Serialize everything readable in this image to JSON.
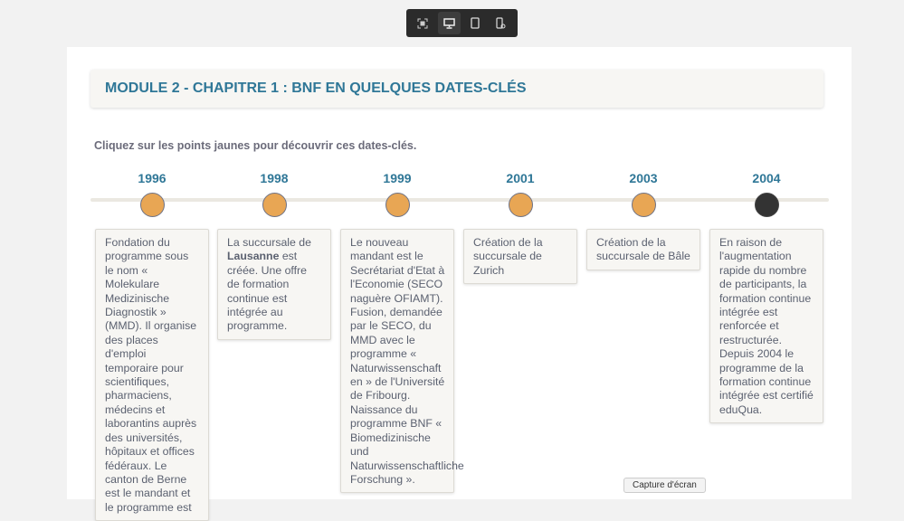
{
  "toolbar": {
    "icons": [
      "fullscreen-icon",
      "desktop-icon",
      "tablet-icon",
      "mobile-rotate-icon"
    ],
    "active": "desktop"
  },
  "header": {
    "title": "MODULE 2 - CHAPITRE 1 : BNF EN QUELQUES DATES-CLÉS"
  },
  "instruction": "Cliquez sur les points jaunes pour découvrir ces dates-clés.",
  "colors": {
    "accent": "#2f7797",
    "dot": "#e8a654",
    "dot_active": "#333333"
  },
  "timeline": [
    {
      "year": "1996",
      "text": "Fondation du programme sous le nom « Molekulare Medizinische Diagnostik » (MMD). Il organise des places d'emploi temporaire pour scientifiques, pharmaciens, médecins et laborantins auprès des universités, hôpitaux et offices fédéraux. Le canton de Berne est le mandant et le programme est"
    },
    {
      "year": "1998",
      "pre": "La succursale de ",
      "bold": "Lausanne",
      "post": " est créée. Une offre de formation continue est intégrée au programme."
    },
    {
      "year": "1999",
      "text": "Le nouveau mandant est le Secrétariat d'Etat à l'Economie (SECO naguère OFIAMT). Fusion, demandée par le SECO, du MMD avec le programme « Naturwissenschaft en » de l'Université de Fribourg. Naissance du programme BNF « Biomedizinische und Naturwissenschaftliche Forschung »."
    },
    {
      "year": "2001",
      "text": "Création de la succursale de Zurich"
    },
    {
      "year": "2003",
      "text": "Création de la succursale de Bâle"
    },
    {
      "year": "2004",
      "text": "En raison de l'augmentation rapide du nombre de participants, la formation continue intégrée est renforcée et restructurée. Depuis 2004 le programme de la formation continue intégrée est certifié eduQua."
    }
  ],
  "capture_label": "Capture d'écran"
}
